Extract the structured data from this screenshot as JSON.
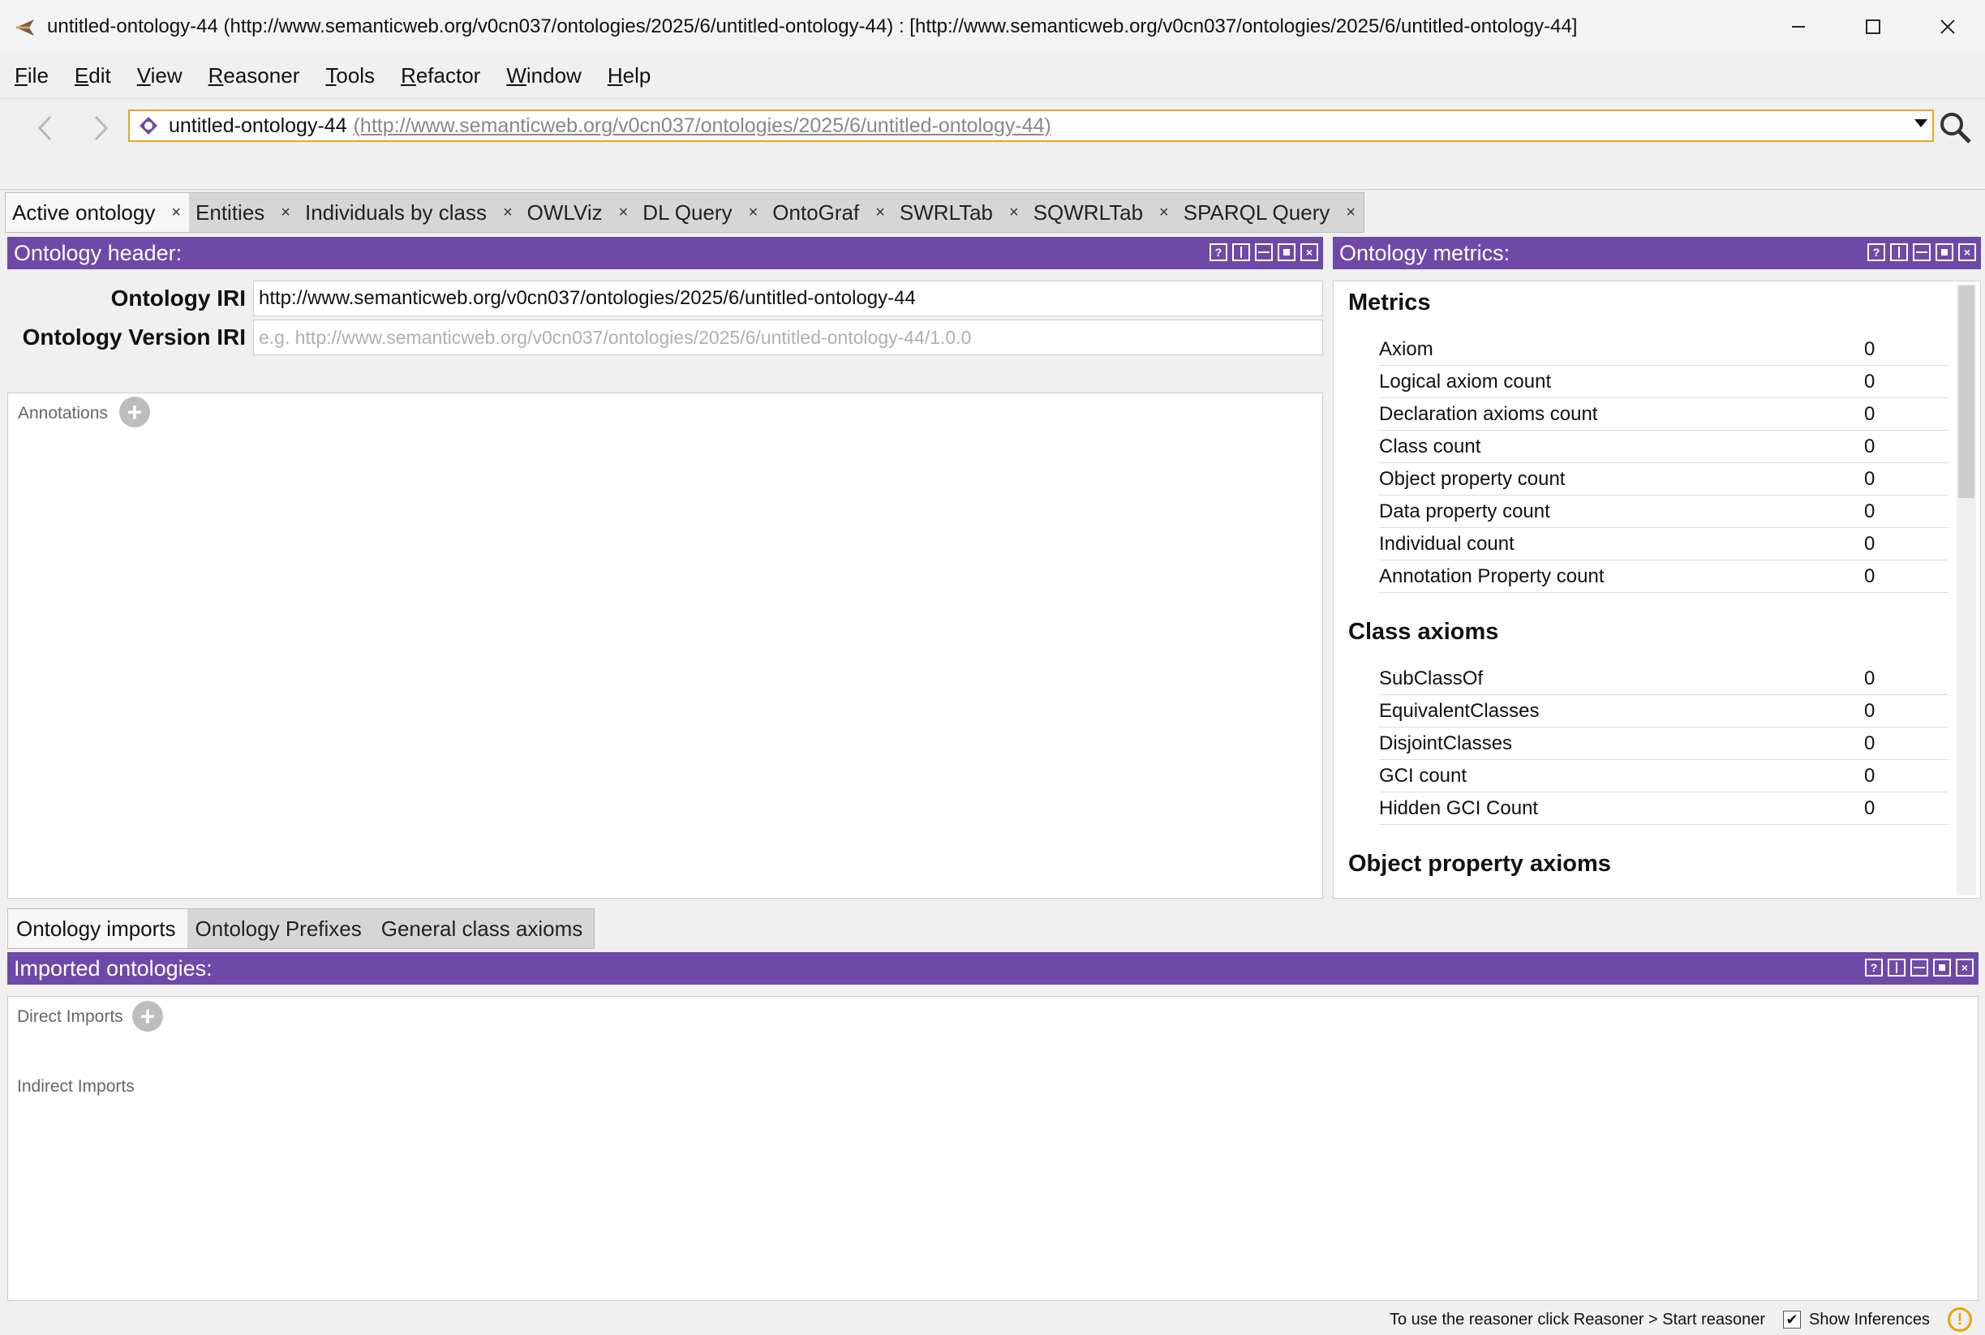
{
  "window": {
    "title": "untitled-ontology-44 (http://www.semanticweb.org/v0cn037/ontologies/2025/6/untitled-ontology-44)  : [http://www.semanticweb.org/v0cn037/ontologies/2025/6/untitled-ontology-44]",
    "controls": [
      "minimize-icon",
      "maximize-icon",
      "close-icon"
    ]
  },
  "menu": {
    "items": [
      {
        "label": "File",
        "mnemonic": "F",
        "rest": "ile"
      },
      {
        "label": "Edit",
        "mnemonic": "E",
        "rest": "dit"
      },
      {
        "label": "View",
        "mnemonic": "V",
        "rest": "iew"
      },
      {
        "label": "Reasoner",
        "mnemonic": "R",
        "rest": "easoner"
      },
      {
        "label": "Tools",
        "mnemonic": "T",
        "rest": "ools"
      },
      {
        "label": "Refactor",
        "mnemonic": "R",
        "rest": "efactor"
      },
      {
        "label": "Window",
        "mnemonic": "W",
        "rest": "indow"
      },
      {
        "label": "Help",
        "mnemonic": "H",
        "rest": "elp"
      }
    ]
  },
  "toolbar": {
    "address_name": "untitled-ontology-44",
    "address_iri": "(http://www.semanticweb.org/v0cn037/ontologies/2025/6/untitled-ontology-44)"
  },
  "tabs": [
    {
      "label": "Active ontology",
      "active": true
    },
    {
      "label": "Entities"
    },
    {
      "label": "Individuals by class"
    },
    {
      "label": "OWLViz"
    },
    {
      "label": "DL Query"
    },
    {
      "label": "OntoGraf"
    },
    {
      "label": "SWRLTab"
    },
    {
      "label": "SQWRLTab"
    },
    {
      "label": "SPARQL Query"
    }
  ],
  "tab_close": "×",
  "ontology_header": {
    "title": "Ontology header:",
    "iri_label": "Ontology IRI",
    "iri_value": "http://www.semanticweb.org/v0cn037/ontologies/2025/6/untitled-ontology-44",
    "version_label": "Ontology Version IRI",
    "version_placeholder": "e.g. http://www.semanticweb.org/v0cn037/ontologies/2025/6/untitled-ontology-44/1.0.0",
    "annotations_label": "Annotations"
  },
  "header_buttons": [
    "?",
    "",
    "",
    "",
    "×"
  ],
  "metrics": {
    "title": "Ontology metrics:",
    "sections": [
      {
        "name": "Metrics",
        "rows": [
          {
            "label": "Axiom",
            "value": "0"
          },
          {
            "label": "Logical axiom count",
            "value": "0"
          },
          {
            "label": "Declaration axioms count",
            "value": "0"
          },
          {
            "label": "Class count",
            "value": "0"
          },
          {
            "label": "Object property count",
            "value": "0"
          },
          {
            "label": "Data property count",
            "value": "0"
          },
          {
            "label": "Individual count",
            "value": "0"
          },
          {
            "label": "Annotation Property count",
            "value": "0"
          }
        ]
      },
      {
        "name": "Class axioms",
        "rows": [
          {
            "label": "SubClassOf",
            "value": "0"
          },
          {
            "label": "EquivalentClasses",
            "value": "0"
          },
          {
            "label": "DisjointClasses",
            "value": "0"
          },
          {
            "label": "GCI count",
            "value": "0"
          },
          {
            "label": "Hidden GCI Count",
            "value": "0"
          }
        ]
      },
      {
        "name": "Object property axioms",
        "rows": []
      }
    ]
  },
  "bottom_tabs": [
    {
      "label": "Ontology imports",
      "active": true
    },
    {
      "label": "Ontology Prefixes"
    },
    {
      "label": "General class axioms"
    }
  ],
  "imports": {
    "title": "Imported ontologies:",
    "direct_label": "Direct Imports",
    "indirect_label": "Indirect Imports"
  },
  "status": {
    "message": "To use the reasoner click Reasoner > Start reasoner",
    "show_inferences_label": "Show Inferences",
    "show_inferences_checked": true,
    "warning_symbol": "!"
  },
  "colors": {
    "panel_header": "#6e49a7",
    "address_border": "#e2a72e"
  }
}
